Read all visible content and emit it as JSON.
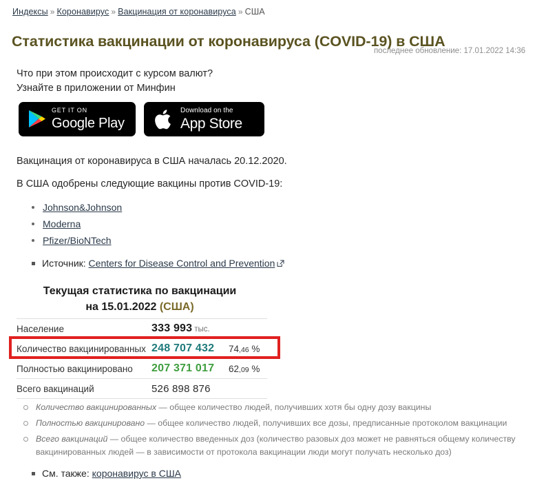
{
  "breadcrumb": {
    "separator": "»",
    "items": [
      {
        "label": "Индексы",
        "link": true
      },
      {
        "label": "Коронавирус",
        "link": true
      },
      {
        "label": "Вакцинация от коронавируса",
        "link": true
      },
      {
        "label": "США",
        "link": false
      }
    ]
  },
  "header": {
    "title": "Статистика вакцинации от коронавируса (COVID-19) в США",
    "updated": "последнее обновление: 17.01.2022 14:36",
    "title_color": "#5b5321"
  },
  "promo": {
    "line1": "Что при этом происходит с курсом валют?",
    "line2": "Узнайте в приложении от Минфин",
    "google_play": {
      "small": "GET IT ON",
      "big": "Google Play",
      "icon": "google-play-icon"
    },
    "app_store": {
      "small": "Download on the",
      "big": "App Store",
      "icon": "apple-logo-icon"
    }
  },
  "body": {
    "start_line": "Вакцинация от коронавируса в США началась 20.12.2020.",
    "approved_line": "В США одобрены следующие вакцины против COVID-19:",
    "vaccines": [
      "Johnson&Johnson",
      "Moderna",
      "Pfizer/BioNTech"
    ],
    "source_label": "Источник:",
    "source_link": "Centers for Disease Control and Prevention",
    "source_icon": "external-link-icon"
  },
  "stats": {
    "title_line1": "Текущая статистика по вакцинации",
    "title_line2_prefix": "на 15.01.2022 ",
    "title_line2_country": "(США)",
    "highlight_color": "#e02020",
    "highlighted_row_index": 1,
    "rows": [
      {
        "label": "Население",
        "value": "333 993",
        "unit": "тыс.",
        "percent": "",
        "value_color": "#1a1a1a",
        "bold": true
      },
      {
        "label": "Количество вакцинированных",
        "value": "248 707 432",
        "unit": "",
        "percent": "74,46 %",
        "value_color": "#1f7a7a",
        "bold": true
      },
      {
        "label": "Полностью вакцинировано",
        "value": "207 371 017",
        "unit": "",
        "percent": "62,09 %",
        "value_color": "#3f9e3f",
        "bold": true
      },
      {
        "label": "Всего вакцинаций",
        "value": "526 898 876",
        "unit": "",
        "percent": "",
        "value_color": "#2b2b2b",
        "bold": false
      }
    ]
  },
  "notes": [
    {
      "term": "Количество вакцинированных",
      "text": " — общее количество людей, получивших хотя бы одну дозу вакцины"
    },
    {
      "term": "Полностью вакцинировано",
      "text": " — общее количество людей, получивших все дозы, предписанные протоколом вакцинации"
    },
    {
      "term": "Всего вакцинаций",
      "text": " — общее количество введенных доз (количество разовых доз может не равняться общему количеству вакцинированных людей — в зависимости от протокола вакцинации люди могут получать несколько доз)"
    }
  ],
  "see_also": {
    "label": "См. также:",
    "link": "коронавирус в США"
  }
}
